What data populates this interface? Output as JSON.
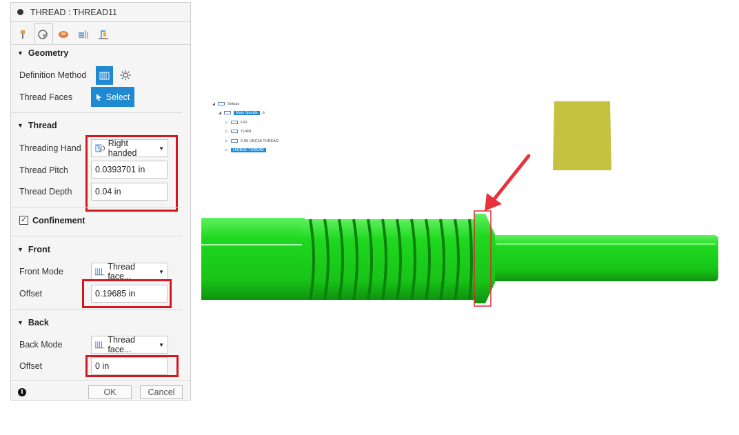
{
  "dialog": {
    "title": "THREAD : THREAD11",
    "tabs": [
      "tool-tab",
      "geometry-tab",
      "heights-tab",
      "passes-tab",
      "linking-tab"
    ],
    "sections": {
      "geometry": {
        "header": "Geometry",
        "definition_method_label": "Definition Method",
        "thread_faces_label": "Thread Faces",
        "select_label": "Select"
      },
      "thread": {
        "header": "Thread",
        "threading_hand_label": "Threading Hand",
        "threading_hand_value": "Right handed",
        "thread_pitch_label": "Thread Pitch",
        "thread_pitch_value": "0.0393701 in",
        "thread_depth_label": "Thread Depth",
        "thread_depth_value": "0.04 in"
      },
      "confinement": {
        "header": "Confinement",
        "checked": true
      },
      "front": {
        "header": "Front",
        "mode_label": "Front Mode",
        "mode_value": "Thread face...",
        "offset_label": "Offset",
        "offset_value": "0.19685 in"
      },
      "back": {
        "header": "Back",
        "mode_label": "Back Mode",
        "mode_value": "Thread face...",
        "offset_label": "Offset",
        "offset_value": "0 in"
      }
    },
    "footer": {
      "ok_label": "OK",
      "cancel_label": "Cancel"
    }
  },
  "browser_tree": {
    "items": [
      {
        "label": "Setups"
      },
      {
        "label": "Main Spindle"
      },
      {
        "label": "F/O"
      },
      {
        "label": "TURN"
      },
      {
        "label": "2-56 UNC2A THREAD"
      },
      {
        "label": "HIGBEE THREAD"
      }
    ]
  },
  "colors": {
    "accent": "#1f8ad2",
    "highlight_red": "#d4161e",
    "part_green": "#22dd22",
    "stock_yellow": "#c5c23f"
  }
}
